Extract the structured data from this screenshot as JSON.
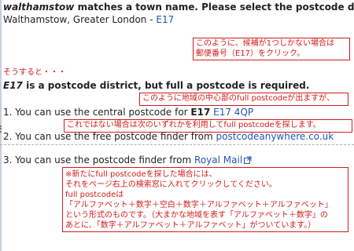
{
  "match": {
    "term": "walthamstow",
    "message": " matches a town name. Please select the postcode d",
    "location": "Walthamstow, Greater London - ",
    "postcode_link": "E17"
  },
  "note1": {
    "line1": "このように、候補が1つしかない場合は",
    "line2": "郵便番号（E17）をクリック。"
  },
  "sonoato": "そうすると・・・",
  "district": {
    "code": "E17",
    "message": " is a postcode district, but full a postcode is required."
  },
  "note2": {
    "text": "このように地域の中心部のfull postcodeが出ますが、"
  },
  "option1": {
    "prefix": "1. You can use the central postcode for ",
    "bold": "E17",
    "link": "E17 4QP"
  },
  "note3": {
    "text": "これではない場合は次のいずれかを利用してfull postcodeを探します。"
  },
  "option2": {
    "prefix": "2. You can use the free postcode finder from ",
    "link": "postcodeanywhere.co.uk"
  },
  "option3": {
    "prefix": "3. You can use the postcode finder from ",
    "link": "Royal Mail",
    "icon": "external-link-icon"
  },
  "note4": {
    "lines": [
      "※新たにfull postcodeを探した場合には、",
      "それをページ右上の検索窓に入れてクリックしてください。",
      "full postcodeは",
      "「アルファベット＋数字＋空白＋数字＋アルファベット＋アルファベット」",
      "という形式のものです。（大まかな地域を表す「アルファベット＋数字」の",
      "あとに、「数字＋アルファベット＋アルファベット」がついています。）"
    ]
  },
  "colors": {
    "link": "#2355b0",
    "annotation": "#d21b1b"
  }
}
